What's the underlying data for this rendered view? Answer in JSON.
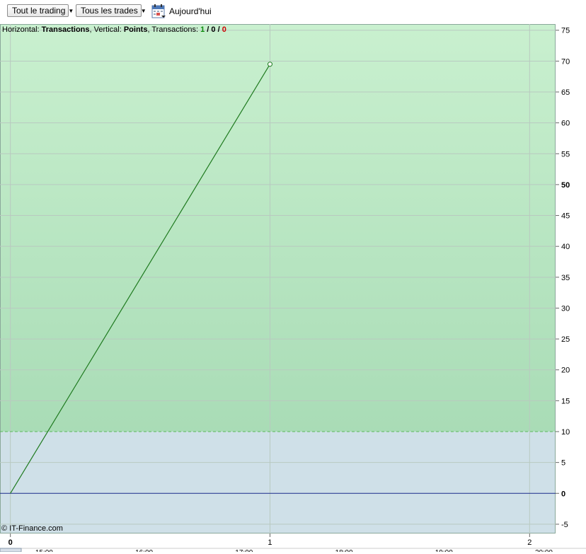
{
  "toolbar": {
    "filter_trading": "Tout le trading",
    "filter_trades": "Tous les trades",
    "today_label": "Aujourd'hui"
  },
  "info": {
    "horizontal_label": "Horizontal:",
    "horizontal_value": "Transactions",
    "vertical_label": "Vertical:",
    "vertical_value": "Points",
    "transactions_label": "Transactions:",
    "tx_total": "1",
    "tx_win": "0",
    "tx_loss": "0",
    "sep": "/"
  },
  "copyright": "© IT-Finance.com",
  "colors": {
    "profit_zone_top": "#c9f0cf",
    "profit_zone_bottom": "#a9dcb6",
    "loss_zone": "#cfe0e8",
    "line": "#1f7a1f",
    "zero_line": "#1a2a8a",
    "threshold_line": "#5cb85c",
    "grid": "#b9c9c0"
  },
  "chart_data": {
    "type": "line",
    "series": [
      {
        "x": [
          0,
          1
        ],
        "values": [
          0,
          69.5
        ]
      }
    ],
    "threshold": 10,
    "ylim": [
      -6.5,
      76
    ],
    "xlim": [
      -0.04,
      2.1
    ],
    "yticks": [
      75,
      70,
      65,
      60,
      55,
      50,
      45,
      40,
      35,
      30,
      25,
      20,
      15,
      10,
      5,
      0,
      -5
    ],
    "ytick_labels": [
      "75",
      "70",
      "65",
      "60",
      "55",
      "50",
      "45",
      "40",
      "35",
      "30",
      "25",
      "20",
      "15",
      "10",
      "5",
      "0",
      "-5"
    ],
    "ytick_bold": [
      "50",
      "0"
    ],
    "xticks": [
      0,
      1,
      2
    ],
    "xtick_labels": [
      "0",
      "1",
      "2"
    ],
    "time_labels": [
      "15:00",
      "16:00",
      "17:00",
      "18:00",
      "19:00",
      "20:00"
    ],
    "time_positions": [
      0.13,
      0.515,
      0.9,
      1.285,
      1.67,
      2.055
    ],
    "grid": true
  }
}
